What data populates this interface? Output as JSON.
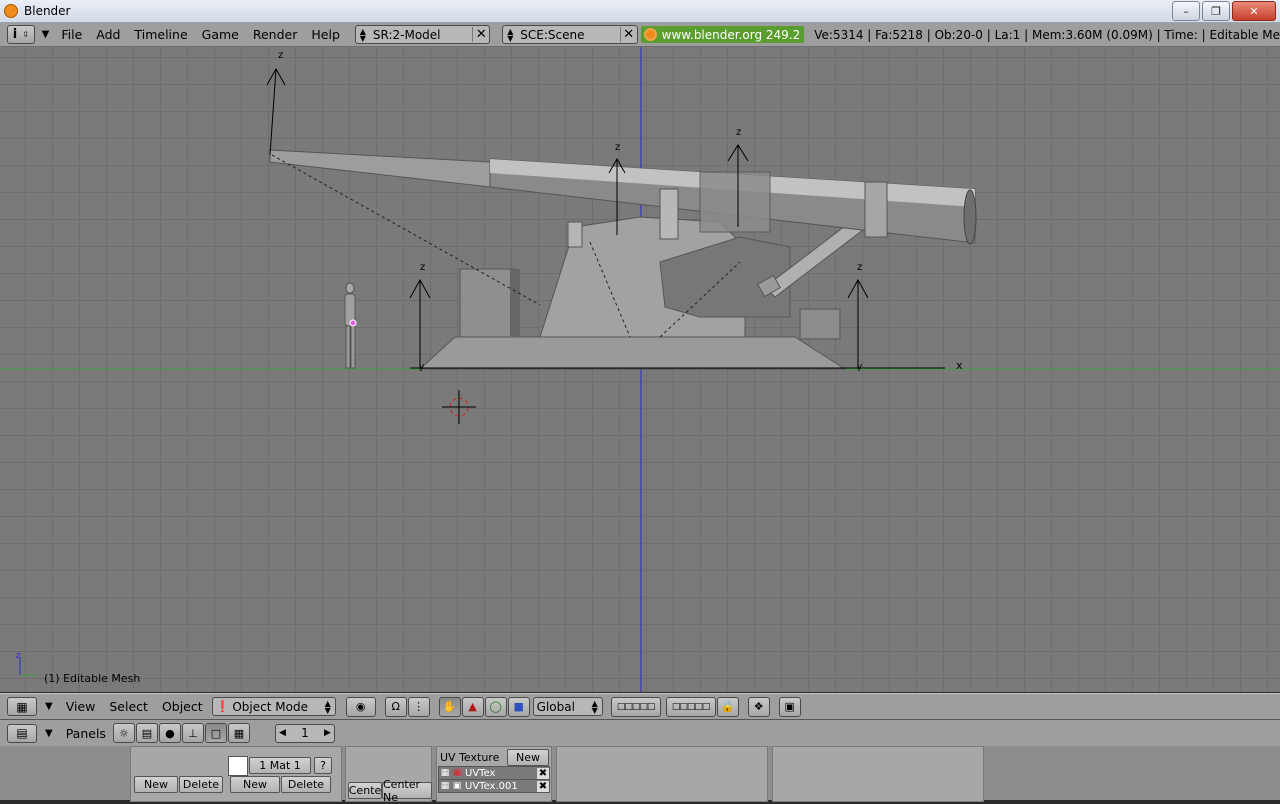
{
  "window": {
    "title": "Blender"
  },
  "menubar": {
    "menus": [
      "File",
      "Add",
      "Timeline",
      "Game",
      "Render",
      "Help"
    ],
    "screen_field": "SR:2-Model",
    "scene_field": "SCE:Scene",
    "url": "www.blender.org 249.2",
    "stats": "Ve:5314 | Fa:5218 | Ob:20-0 | La:1  | Mem:3.60M (0.09M)  | Time: | Editable Me"
  },
  "viewport": {
    "label": "(1) Editable Mesh",
    "axis_z": "z",
    "axis_y": "y",
    "axis_x": "x",
    "colors": {
      "background": "#7a7a7a",
      "grid": "#6e6e6e",
      "x_axis": "#3fa03f",
      "z_axis": "#2a2ad0"
    }
  },
  "header3d": {
    "menus": [
      "View",
      "Select",
      "Object"
    ],
    "mode": "Object Mode",
    "orientation": "Global"
  },
  "buttons_window": {
    "panels_label": "Panels",
    "frame": "1",
    "material": "1 Mat 1",
    "help": "?",
    "new1": "New",
    "delete1": "Delete",
    "new2": "New",
    "delete2": "Delete",
    "center": "Cente",
    "center_new": "Center Ne",
    "uv_texture_label": "UV Texture",
    "uv_new": "New",
    "uv_layers": [
      "UVTex",
      "UVTex.001"
    ]
  }
}
